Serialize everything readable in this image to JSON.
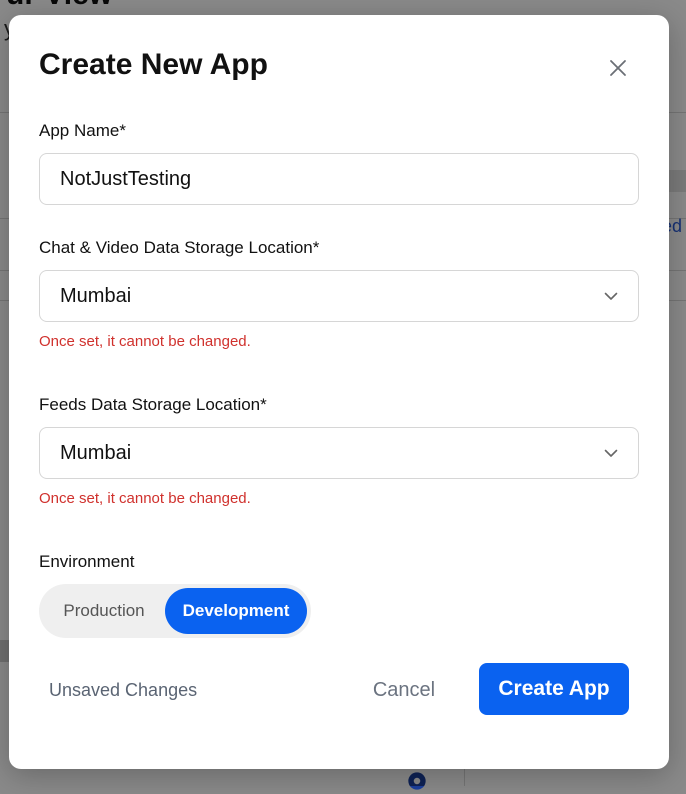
{
  "background": {
    "heading": "ur View",
    "subheading": "y",
    "link_text": "ed"
  },
  "modal": {
    "title": "Create New App",
    "close_icon": "close-icon",
    "app_name": {
      "label": "App Name*",
      "value": "NotJustTesting"
    },
    "chat_storage": {
      "label": "Chat & Video Data Storage Location*",
      "selected": "Mumbai",
      "warning": "Once set, it cannot be changed."
    },
    "feeds_storage": {
      "label": "Feeds Data Storage Location*",
      "selected": "Mumbai",
      "warning": "Once set, it cannot be changed."
    },
    "environment": {
      "label": "Environment",
      "options": [
        "Production",
        "Development"
      ],
      "selected": "Development"
    },
    "footer": {
      "status": "Unsaved Changes",
      "cancel_label": "Cancel",
      "create_label": "Create App"
    }
  },
  "colors": {
    "primary": "#0a62f0",
    "warning": "#d0312d",
    "muted_text": "#6b7380"
  }
}
